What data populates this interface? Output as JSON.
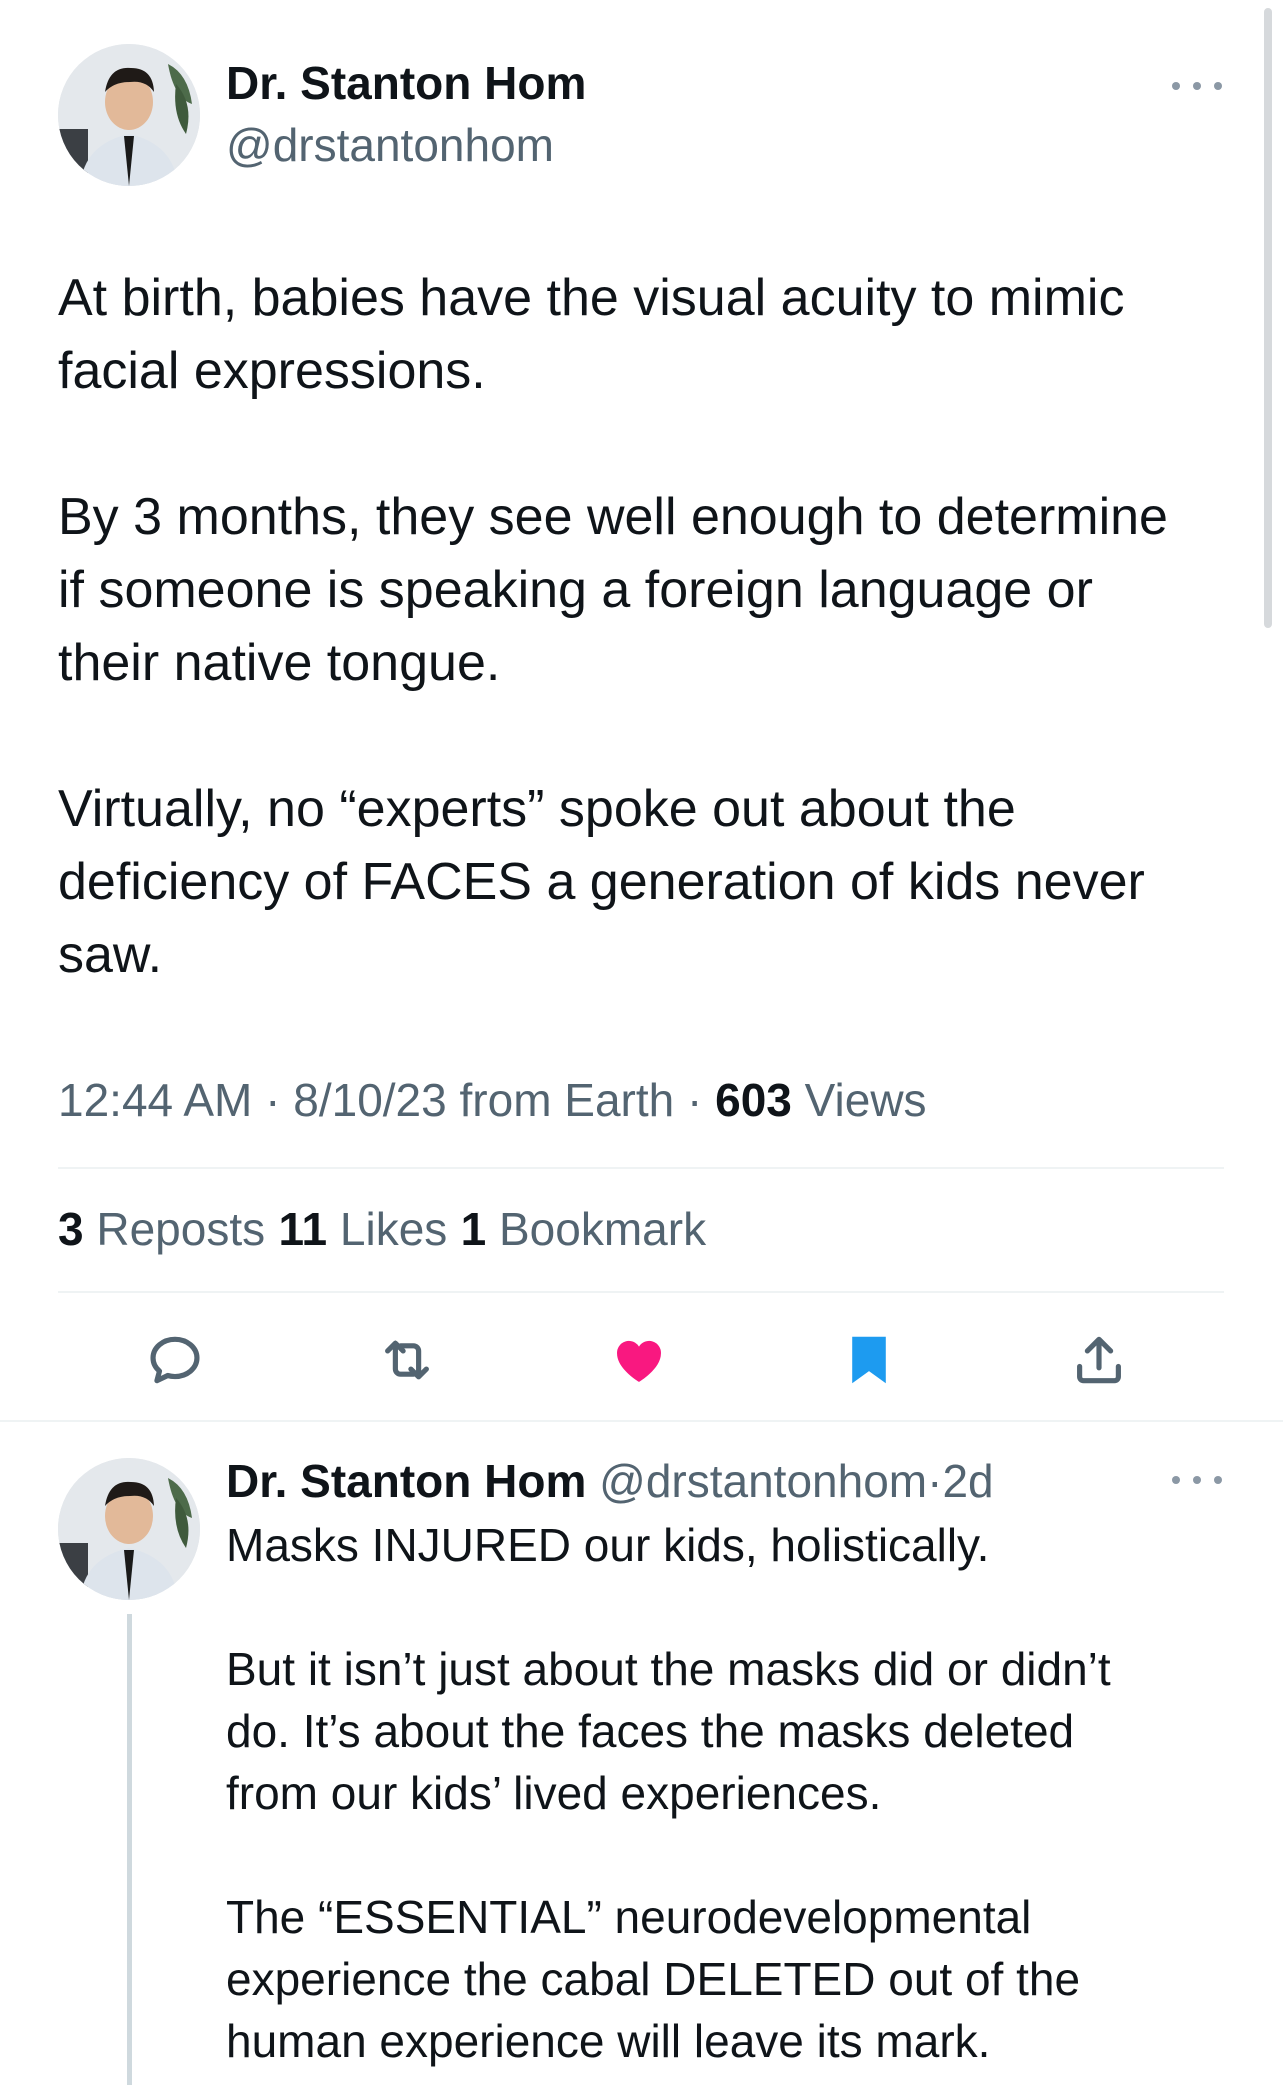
{
  "tweet": {
    "author_name": "Dr. Stanton Hom",
    "handle": "@drstantonhom",
    "avatar_icon": "avatar-photo",
    "text": "At birth, babies have the visual acuity to mimic\nfacial expressions.\n\nBy 3 months, they see well enough to determine\nif someone is speaking a foreign language or\ntheir native tongue.\n\nVirtually, no “experts” spoke out about the\ndeficiency of FACES a generation of kids never\nsaw.",
    "time": "12:44 AM",
    "date": "8/10/23",
    "location": "from Earth",
    "sep": "·",
    "views_count": "603",
    "views_label": "Views",
    "reposts_count": "3",
    "reposts_label": "Reposts",
    "likes_count": "11",
    "likes_label": "Likes",
    "bookmarks_count": "1",
    "bookmarks_label": "Bookmark",
    "actions": [
      "reply-icon",
      "repost-icon",
      "like-icon",
      "bookmark-icon",
      "share-icon"
    ],
    "colors": {
      "like": "#f91880",
      "bookmark": "#1d9bf0",
      "muted": "#536471"
    }
  },
  "reply": {
    "author_name": "Dr. Stanton Hom",
    "handle": "@drstantonhom",
    "sep": "·",
    "age": "2d",
    "text": "Masks INJURED our kids, holistically.\n\nBut it isn’t just about the masks did or didn’t\ndo. It’s about the faces the masks deleted\nfrom our kids’ lived experiences.\n\nThe “ESSENTIAL” neurodevelopmental\nexperience the cabal DELETED out of the\nhuman experience will leave its mark."
  }
}
